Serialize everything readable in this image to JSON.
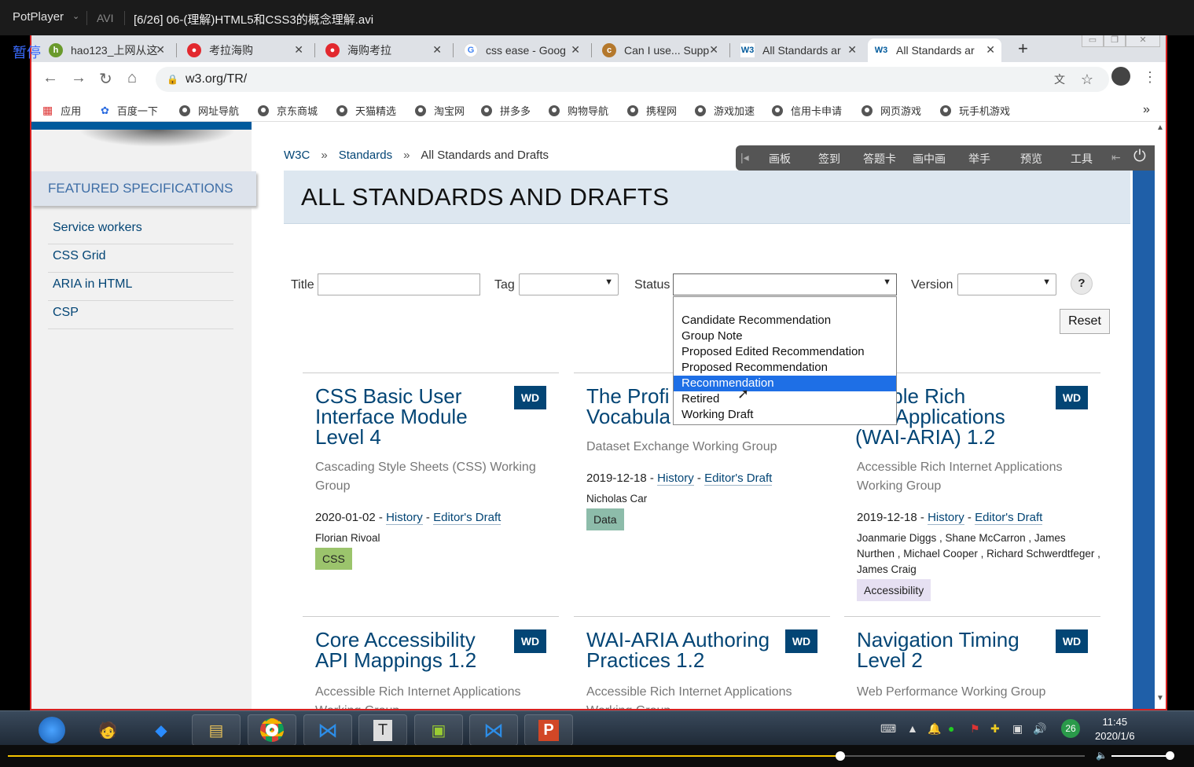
{
  "player": {
    "logo": "PotPlayer",
    "format": "AVI",
    "file_title": "[6/26] 06-(理解)HTML5和CSS3的概念理解.avi",
    "paused_label": "暂停"
  },
  "browser": {
    "tabs": [
      {
        "label": "hao123_上网从这",
        "fav": "hao"
      },
      {
        "label": "考拉海购",
        "fav": "red"
      },
      {
        "label": "海购考拉",
        "fav": "red"
      },
      {
        "label": "css ease - Goog",
        "fav": "G"
      },
      {
        "label": "Can I use... Supp",
        "fav": "ciu"
      },
      {
        "label": "All Standards ar",
        "fav": "W3"
      },
      {
        "label": "All Standards ar",
        "fav": "W3"
      }
    ],
    "new_tab": "+",
    "url": "w3.org/TR/",
    "bookmarks": [
      "应用",
      "百度一下",
      "网址导航",
      "京东商城",
      "天猫精选",
      "淘宝网",
      "拼多多",
      "购物导航",
      "携程网",
      "游戏加速",
      "信用卡申请",
      "网页游戏",
      "玩手机游戏"
    ],
    "more": "»"
  },
  "overlay_toolbar": [
    "画板",
    "签到",
    "答题卡",
    "画中画",
    "举手",
    "预览",
    "工具"
  ],
  "sidebar": {
    "featured_title": "FEATURED SPECIFICATIONS",
    "items": [
      "Service workers",
      "CSS Grid",
      "ARIA in HTML",
      "CSP"
    ]
  },
  "breadcrumb": {
    "root": "W3C",
    "sep": "»",
    "level1": "Standards",
    "current": "All Standards and Drafts"
  },
  "page_title": "ALL STANDARDS AND DRAFTS",
  "filters": {
    "title_label": "Title",
    "tag_label": "Tag",
    "status_label": "Status",
    "version_label": "Version",
    "help": "?",
    "reset": "Reset",
    "status_options": [
      "",
      "Candidate Recommendation",
      "Group Note",
      "Proposed Edited Recommendation",
      "Proposed Recommendation",
      "Recommendation",
      "Retired",
      "Working Draft"
    ],
    "status_highlighted": "Recommendation"
  },
  "cards": [
    {
      "title": "CSS Basic User Interface Module Level 4",
      "badge": "WD",
      "group": "Cascading Style Sheets (CSS) Working Group",
      "date": "2020-01-02 -",
      "history": "History",
      "dash": "-",
      "draft": "Editor's Draft",
      "editors": "Florian Rivoal",
      "tag": "CSS",
      "tag_color": "#9bc46c"
    },
    {
      "title": "The Profile Vocabulary",
      "title_visible": "The Profi\nVocabula",
      "badge": "WD",
      "group": "Dataset Exchange Working Group",
      "date": "2019-12-18 -",
      "history": "History",
      "dash": "-",
      "draft": "Editor's Draft",
      "editors": "Nicholas Car",
      "tag": "Data",
      "tag_color": "#8dbcaa"
    },
    {
      "title": "Accessible Rich Internet Applications (WAI-ARIA) 1.2",
      "title_visible": "essible Rich\nrnet Applications\n(WAI-ARIA) 1.2",
      "badge": "WD",
      "group": "Accessible Rich Internet Applications Working Group",
      "date": "2019-12-18 -",
      "history": "History",
      "dash": "-",
      "draft": "Editor's Draft",
      "editors": "Joanmarie Diggs , Shane McCarron , James Nurthen , Michael Cooper , Richard Schwerdtfeger , James Craig",
      "tag": "Accessibility",
      "tag_color": "#e6e0f2"
    },
    {
      "title": "Core Accessibility API Mappings 1.2",
      "badge": "WD",
      "group": "Accessible Rich Internet Applications Working Group"
    },
    {
      "title": "WAI-ARIA Authoring Practices 1.2",
      "badge": "WD",
      "group": "Accessible Rich Internet Applications Working Group"
    },
    {
      "title": "Navigation Timing Level 2",
      "badge": "WD",
      "group": "Web Performance Working Group"
    }
  ],
  "taskbar": {
    "time": "11:45",
    "date": "2020/1/6",
    "badge": "26"
  }
}
